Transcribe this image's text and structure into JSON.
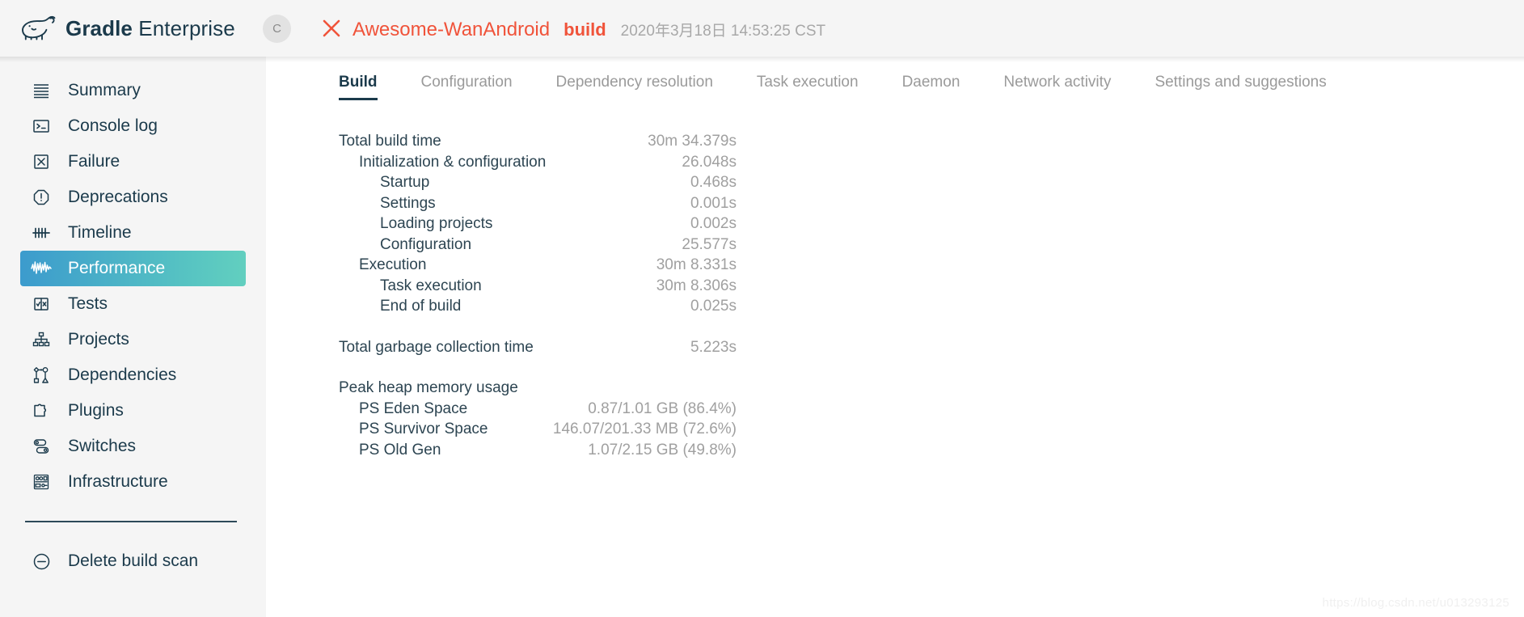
{
  "header": {
    "brand_strong": "Gradle",
    "brand_light": "Enterprise",
    "logo_icon": "gradle-elephant-logo",
    "avatar_initial": "C",
    "status_icon": "failure-x-icon",
    "project_name": "Awesome-WanAndroid",
    "build_word": "build",
    "build_date": "2020年3月18日 14:53:25 CST"
  },
  "sidebar": {
    "items": [
      {
        "label": "Summary",
        "icon": "summary-lines-icon",
        "active": false
      },
      {
        "label": "Console log",
        "icon": "console-prompt-icon",
        "active": false
      },
      {
        "label": "Failure",
        "icon": "failure-box-x-icon",
        "active": false
      },
      {
        "label": "Deprecations",
        "icon": "warning-octagon-icon",
        "active": false
      },
      {
        "label": "Timeline",
        "icon": "timeline-ticks-icon",
        "active": false
      },
      {
        "label": "Performance",
        "icon": "performance-wave-icon",
        "active": true
      },
      {
        "label": "Tests",
        "icon": "tests-check-x-icon",
        "active": false
      },
      {
        "label": "Projects",
        "icon": "projects-tree-icon",
        "active": false
      },
      {
        "label": "Dependencies",
        "icon": "dependencies-graph-icon",
        "active": false
      },
      {
        "label": "Plugins",
        "icon": "plugins-puzzle-icon",
        "active": false
      },
      {
        "label": "Switches",
        "icon": "switches-toggle-icon",
        "active": false
      },
      {
        "label": "Infrastructure",
        "icon": "infrastructure-icon",
        "active": false
      }
    ],
    "footer": {
      "label": "Delete build scan",
      "icon": "minus-circle-icon"
    }
  },
  "tabs": [
    {
      "label": "Build",
      "active": true
    },
    {
      "label": "Configuration",
      "active": false
    },
    {
      "label": "Dependency resolution",
      "active": false
    },
    {
      "label": "Task execution",
      "active": false
    },
    {
      "label": "Daemon",
      "active": false
    },
    {
      "label": "Network activity",
      "active": false
    },
    {
      "label": "Settings and suggestions",
      "active": false
    }
  ],
  "metrics": {
    "build_time": [
      {
        "label": "Total build time",
        "value": "30m 34.379s",
        "level": 0
      },
      {
        "label": "Initialization & configuration",
        "value": "26.048s",
        "level": 1
      },
      {
        "label": "Startup",
        "value": "0.468s",
        "level": 2
      },
      {
        "label": "Settings",
        "value": "0.001s",
        "level": 2
      },
      {
        "label": "Loading projects",
        "value": "0.002s",
        "level": 2
      },
      {
        "label": "Configuration",
        "value": "25.577s",
        "level": 2
      },
      {
        "label": "Execution",
        "value": "30m 8.331s",
        "level": 1
      },
      {
        "label": "Task execution",
        "value": "30m 8.306s",
        "level": 2
      },
      {
        "label": "End of build",
        "value": "0.025s",
        "level": 2
      }
    ],
    "gc": [
      {
        "label": "Total garbage collection time",
        "value": "5.223s",
        "level": 0
      }
    ],
    "heap_title": "Peak heap memory usage",
    "heap": [
      {
        "label": "PS Eden Space",
        "value": "0.87/1.01 GB (86.4%)",
        "level": 1
      },
      {
        "label": "PS Survivor Space",
        "value": "146.07/201.33 MB (72.6%)",
        "level": 1
      },
      {
        "label": "PS Old Gen",
        "value": "1.07/2.15 GB (49.8%)",
        "level": 1
      }
    ]
  },
  "watermark": "https://blog.csdn.net/u013293125",
  "colors": {
    "accent_red": "#f0533a",
    "ink": "#1b3a4b",
    "muted": "#a0a0a0",
    "sidebar_bg": "#f5f5f5",
    "active_gradient_start": "#3c9bcd",
    "active_gradient_end": "#62cfbf"
  }
}
